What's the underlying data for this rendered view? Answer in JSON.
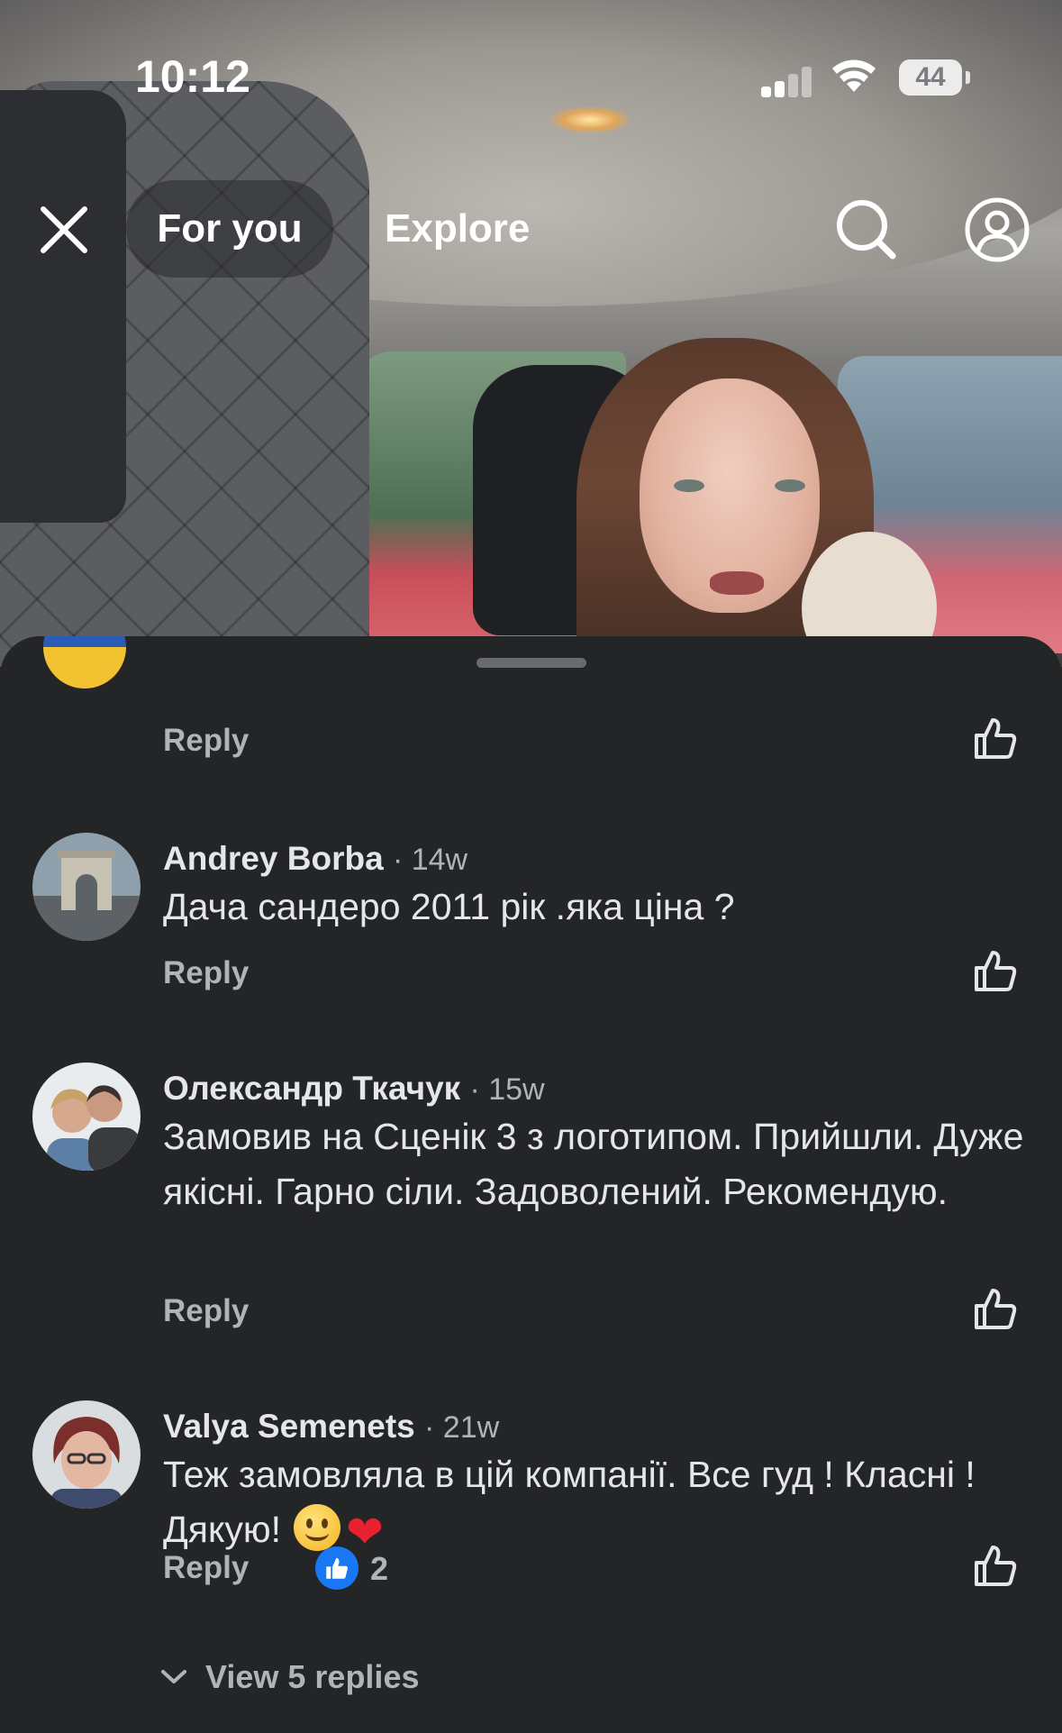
{
  "status_bar": {
    "time": "10:12",
    "battery": "44"
  },
  "nav": {
    "tab_foryou": "For you",
    "tab_explore": "Explore"
  },
  "comments": [
    {
      "reply_label": "Reply"
    },
    {
      "author": "Andrey Borba",
      "time": "· 14w",
      "text": "Дача сандеро 2011 рік .яка ціна ?",
      "reply_label": "Reply"
    },
    {
      "author": "Олександр Ткачук",
      "time": "· 15w",
      "text": "Замовив на Сценік 3 з логотипом. Прийшли. Дуже якісні. Гарно сіли. Задоволений. Рекомендую.",
      "reply_label": "Reply"
    },
    {
      "author": "Valya Semenets",
      "time": "· 21w",
      "text": "Теж замовляла в цій компанії. Все гуд ! Класні !  Дякую!",
      "reply_label": "Reply",
      "reaction_count": "2",
      "view_replies": "View 5 replies"
    }
  ],
  "icons": {
    "close": "close-icon",
    "search": "search-icon",
    "profile": "profile-icon",
    "like": "thumbs-up-icon",
    "chevron": "chevron-down-icon"
  },
  "colors": {
    "sheet_bg": "#242526",
    "text_primary": "#e4e6eb",
    "text_secondary": "#b0b3b8",
    "reaction_blue": "#1877f2"
  }
}
